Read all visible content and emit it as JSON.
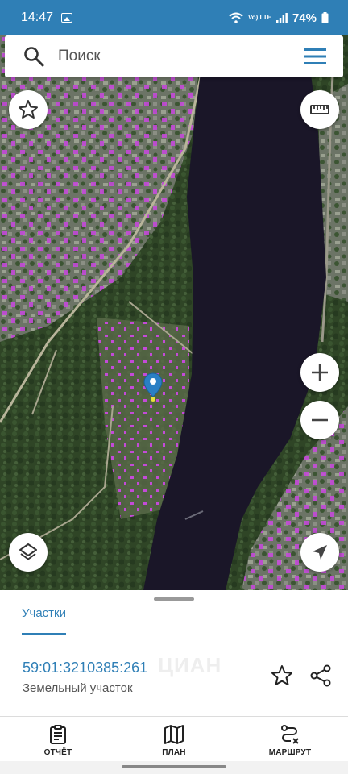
{
  "status_bar": {
    "time": "14:47",
    "network_label": "Vo) LTE",
    "battery": "74%"
  },
  "search": {
    "placeholder": "Поиск",
    "icon": "search-icon",
    "menu_icon": "hamburger-menu-icon"
  },
  "map_controls": {
    "favorite_icon": "star-outline-icon",
    "ruler_icon": "ruler-icon",
    "zoom_in_icon": "plus-icon",
    "zoom_out_icon": "minus-icon",
    "layers_icon": "layers-icon",
    "locate_icon": "navigation-arrow-icon"
  },
  "panel": {
    "tab_label": "Участки",
    "parcel_number": "59:01:3210385:261",
    "parcel_type": "Земельный участок",
    "watermark": "ЦИАН"
  },
  "nav": {
    "items": [
      {
        "label": "ОТЧЁТ",
        "icon": "clipboard-report-icon"
      },
      {
        "label": "ПЛАН",
        "icon": "map-plan-icon"
      },
      {
        "label": "МАРШРУТ",
        "icon": "route-icon"
      }
    ]
  },
  "colors": {
    "accent": "#2f7fb6",
    "parcel_highlight": "#c44ad8",
    "river": "#1a1628",
    "marker": "#2a7fc4"
  }
}
